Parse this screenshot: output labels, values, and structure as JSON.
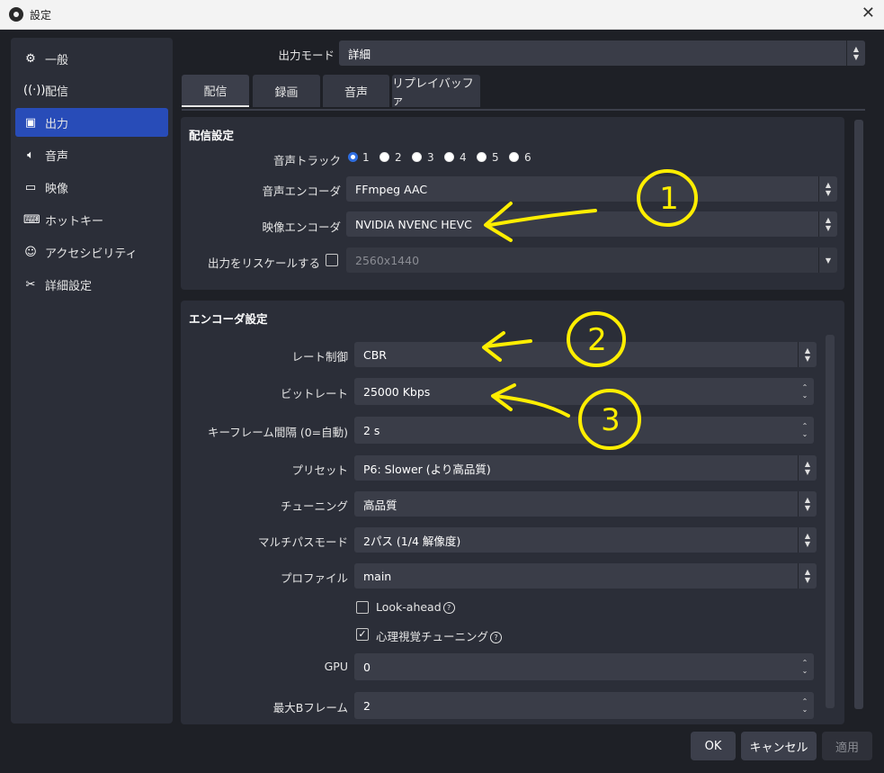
{
  "window": {
    "title": "設定"
  },
  "sidebar": {
    "items": [
      {
        "label": "一般",
        "icon": "gear-icon"
      },
      {
        "label": "配信",
        "icon": "broadcast-icon"
      },
      {
        "label": "出力",
        "icon": "output-icon"
      },
      {
        "label": "音声",
        "icon": "speaker-icon"
      },
      {
        "label": "映像",
        "icon": "monitor-icon"
      },
      {
        "label": "ホットキー",
        "icon": "keyboard-icon"
      },
      {
        "label": "アクセシビリティ",
        "icon": "accessibility-icon"
      },
      {
        "label": "詳細設定",
        "icon": "tools-icon"
      }
    ],
    "active_index": 2
  },
  "output_mode": {
    "label": "出力モード",
    "value": "詳細"
  },
  "tabs": [
    "配信",
    "録画",
    "音声",
    "リプレイバッファ"
  ],
  "active_tab": 0,
  "stream_settings": {
    "title": "配信設定",
    "audio_track": {
      "label": "音声トラック",
      "options": [
        "1",
        "2",
        "3",
        "4",
        "5",
        "6"
      ],
      "selected": "1"
    },
    "audio_encoder": {
      "label": "音声エンコーダ",
      "value": "FFmpeg AAC"
    },
    "video_encoder": {
      "label": "映像エンコーダ",
      "value": "NVIDIA NVENC HEVC"
    },
    "rescale": {
      "label": "出力をリスケールする",
      "checked": false,
      "value": "2560x1440"
    }
  },
  "encoder_settings": {
    "title": "エンコーダ設定",
    "rate_control": {
      "label": "レート制御",
      "value": "CBR"
    },
    "bitrate": {
      "label": "ビットレート",
      "value": "25000 Kbps"
    },
    "keyframe": {
      "label": "キーフレーム間隔 (0=自動)",
      "value": "2 s"
    },
    "preset": {
      "label": "プリセット",
      "value": "P6: Slower (より高品質)"
    },
    "tuning": {
      "label": "チューニング",
      "value": "高品質"
    },
    "multipass": {
      "label": "マルチパスモード",
      "value": "2パス (1/4 解像度)"
    },
    "profile": {
      "label": "プロファイル",
      "value": "main"
    },
    "lookahead": {
      "label": "Look-ahead",
      "checked": false
    },
    "psycho": {
      "label": "心理視覚チューニング",
      "checked": true
    },
    "gpu": {
      "label": "GPU",
      "value": "0"
    },
    "bframes": {
      "label": "最大Bフレーム",
      "value": "2"
    }
  },
  "buttons": {
    "ok": "OK",
    "cancel": "キャンセル",
    "apply": "適用"
  },
  "annotations": {
    "mark1": "1",
    "mark2": "2",
    "mark3": "3",
    "color": "#ffee00"
  },
  "colors": {
    "accent": "#284cb8",
    "background": "#1e2026",
    "panel": "#2b2e38"
  }
}
